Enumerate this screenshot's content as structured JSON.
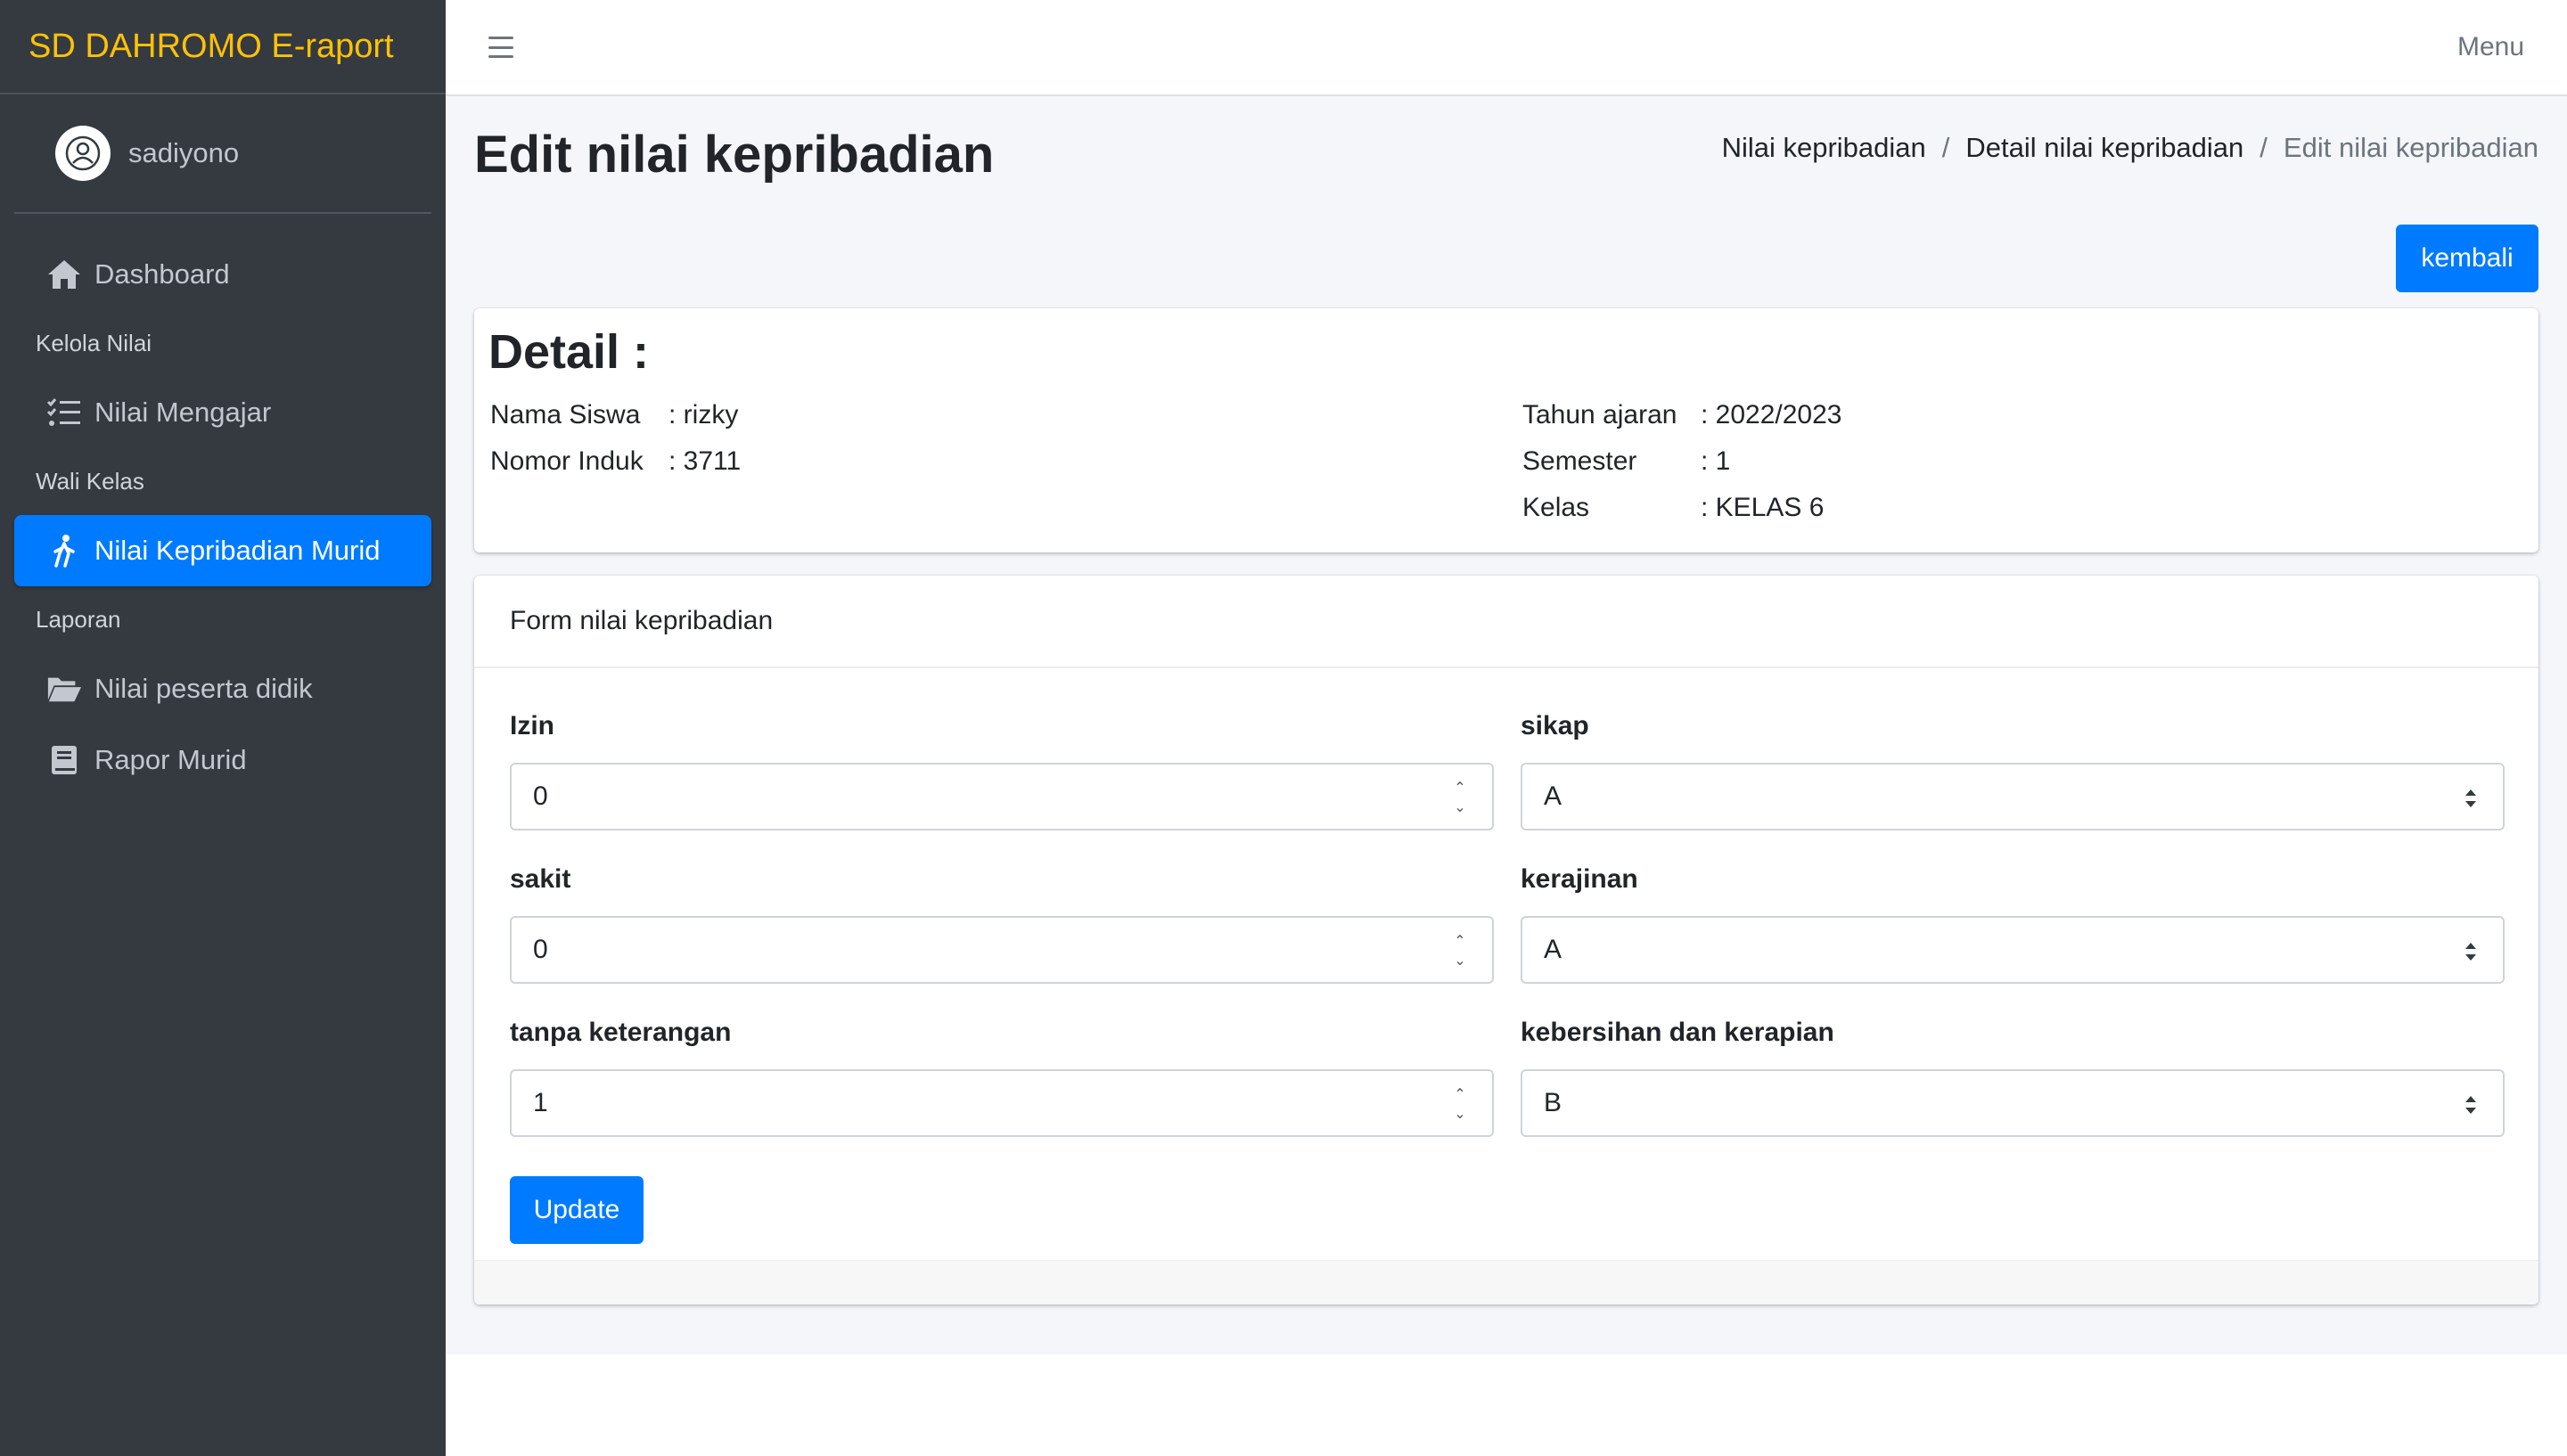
{
  "app": {
    "brand": "SD DAHROMO E-raport",
    "user": "sadiyono",
    "menu_label": "Menu"
  },
  "sidebar": {
    "items": [
      {
        "type": "item",
        "label": "Dashboard",
        "icon": "home-icon"
      },
      {
        "type": "header",
        "label": "Kelola Nilai"
      },
      {
        "type": "item",
        "label": "Nilai Mengajar",
        "icon": "list-check-icon"
      },
      {
        "type": "header",
        "label": "Wali Kelas"
      },
      {
        "type": "item",
        "label": "Nilai Kepribadian Murid",
        "icon": "walking-person-icon",
        "active": true
      },
      {
        "type": "header",
        "label": "Laporan"
      },
      {
        "type": "item",
        "label": "Nilai peserta didik",
        "icon": "folder-open-icon"
      },
      {
        "type": "item",
        "label": "Rapor Murid",
        "icon": "book-icon"
      }
    ]
  },
  "page": {
    "title": "Edit nilai kepribadian",
    "breadcrumb": [
      "Nilai kepribadian",
      "Detail nilai kepribadian",
      "Edit nilai kepribadian"
    ],
    "back_button": "kembali"
  },
  "detail": {
    "title": "Detail :",
    "left": [
      {
        "label": "Nama Siswa",
        "value": ": rizky"
      },
      {
        "label": "Nomor Induk",
        "value": ": 3711"
      }
    ],
    "right": [
      {
        "label": "Tahun ajaran",
        "value": ": 2022/2023"
      },
      {
        "label": "Semester",
        "value": ": 1"
      },
      {
        "label": "Kelas",
        "value": ": KELAS 6"
      }
    ]
  },
  "form": {
    "header": "Form nilai kepribadian",
    "fields": {
      "izin": {
        "label": "Izin",
        "value": "0"
      },
      "sakit": {
        "label": "sakit",
        "value": "0"
      },
      "tanpa_keterangan": {
        "label": "tanpa keterangan",
        "value": "1"
      },
      "sikap": {
        "label": "sikap",
        "value": "A"
      },
      "kerajinan": {
        "label": "kerajinan",
        "value": "A"
      },
      "kebersihan": {
        "label": "kebersihan dan kerapian",
        "value": "B"
      }
    },
    "submit": "Update"
  },
  "colors": {
    "sidebar_bg": "#343a40",
    "brand": "#ffc107",
    "primary": "#007bff"
  }
}
